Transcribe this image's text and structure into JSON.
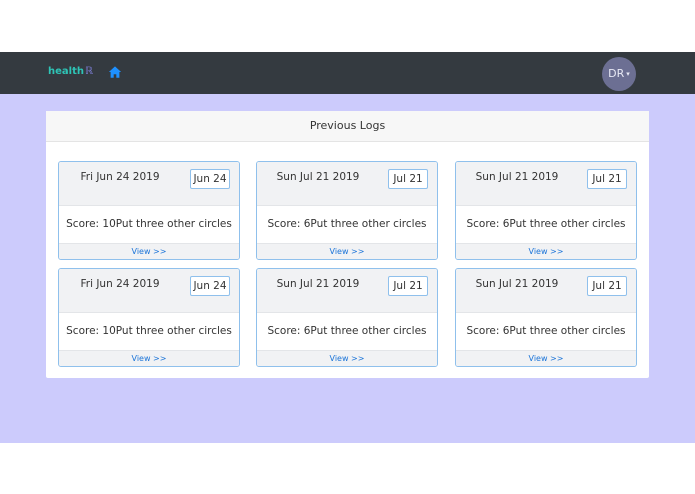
{
  "navbar": {
    "brand_text": "health",
    "brand_suffix": "ℝ",
    "avatar_initials": "DR",
    "avatar_caret": "▾"
  },
  "panel": {
    "title": "Previous Logs"
  },
  "cards": [
    {
      "date": "Fri Jun 24 2019",
      "badge": "Jun 24",
      "body": "Score: 10Put three other circles",
      "link": "View >>"
    },
    {
      "date": "Sun Jul 21 2019",
      "badge": "Jul 21",
      "body": "Score: 6Put three other circles",
      "link": "View >>"
    },
    {
      "date": "Sun Jul 21 2019",
      "badge": "Jul 21",
      "body": "Score: 6Put three other circles",
      "link": "View >>"
    },
    {
      "date": "Fri Jun 24 2019",
      "badge": "Jun 24",
      "body": "Score: 10Put three other circles",
      "link": "View >>"
    },
    {
      "date": "Sun Jul 21 2019",
      "badge": "Jul 21",
      "body": "Score: 6Put three other circles",
      "link": "View >>"
    },
    {
      "date": "Sun Jul 21 2019",
      "badge": "Jul 21",
      "body": "Score: 6Put three other circles",
      "link": "View >>"
    }
  ],
  "colors": {
    "navbar": "#343a40",
    "background": "#cccbfc",
    "brand": "#2ec4b6",
    "link": "#1b74d8",
    "card_border": "#8fc0ec"
  },
  "icons": {
    "home": "home-icon"
  }
}
